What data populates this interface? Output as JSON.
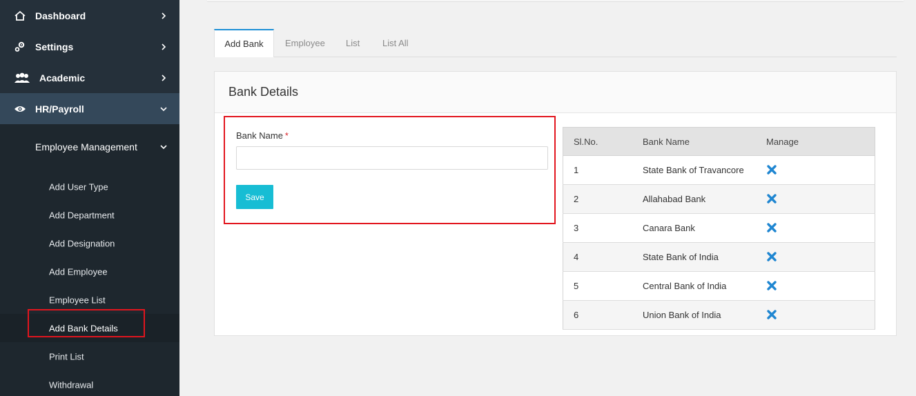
{
  "sidebar": {
    "top_items": [
      {
        "label": "Dashboard",
        "icon": "home-icon"
      },
      {
        "label": "Settings",
        "icon": "gears-icon"
      },
      {
        "label": "Academic",
        "icon": "users-icon"
      },
      {
        "label": "HR/Payroll",
        "icon": "eye-icon",
        "expanded": true
      }
    ],
    "submenu_title": "Employee Management",
    "leaf_items": [
      {
        "label": "Add User Type"
      },
      {
        "label": "Add Department"
      },
      {
        "label": "Add Designation"
      },
      {
        "label": "Add Employee"
      },
      {
        "label": "Employee List"
      },
      {
        "label": "Add Bank Details",
        "current": true
      },
      {
        "label": "Print List"
      },
      {
        "label": "Withdrawal"
      }
    ]
  },
  "tabs": [
    {
      "label": "Add Bank",
      "active": true
    },
    {
      "label": "Employee"
    },
    {
      "label": "List"
    },
    {
      "label": "List All"
    }
  ],
  "panel": {
    "title": "Bank Details",
    "form": {
      "label": "Bank Name",
      "required_marker": "*",
      "value": "",
      "placeholder": "",
      "save_label": "Save"
    },
    "table": {
      "headers": [
        "Sl.No.",
        "Bank Name",
        "Manage"
      ],
      "rows": [
        {
          "no": "1",
          "name": "State Bank of Travancore"
        },
        {
          "no": "2",
          "name": "Allahabad Bank"
        },
        {
          "no": "3",
          "name": "Canara Bank"
        },
        {
          "no": "4",
          "name": "State Bank of India"
        },
        {
          "no": "5",
          "name": "Central Bank of India"
        },
        {
          "no": "6",
          "name": "Union Bank of India"
        }
      ],
      "manage_icon": "delete-x-icon"
    }
  },
  "colors": {
    "sidebar_bg": "#25303a",
    "active_nav_bg": "#34485a",
    "accent_tab": "#1b8ed6",
    "save_button": "#17bdd4",
    "delete_icon": "#1f86d1",
    "highlight_box": "#e2151e"
  }
}
